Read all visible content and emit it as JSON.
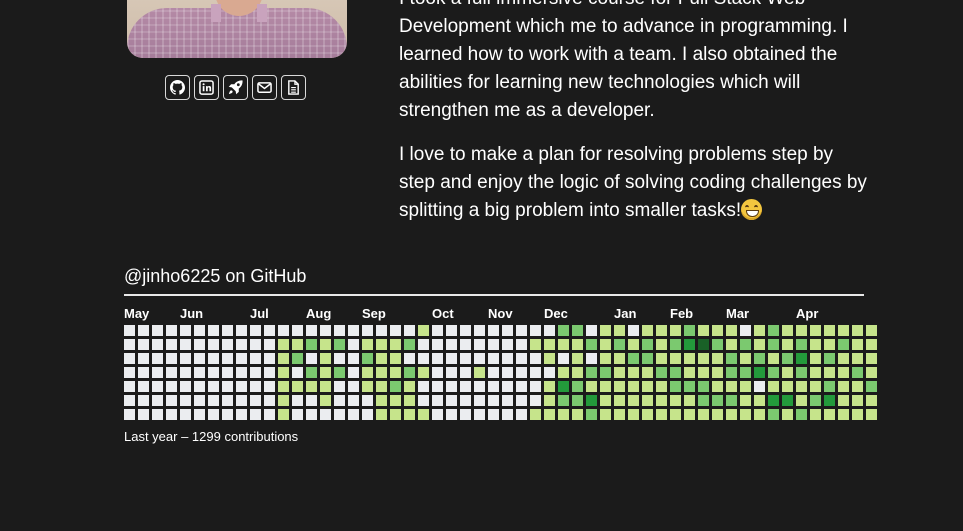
{
  "profile": {
    "photo_alt": "profile photo",
    "socials": [
      {
        "icon": "github-icon"
      },
      {
        "icon": "linkedin-icon"
      },
      {
        "icon": "rocket-icon"
      },
      {
        "icon": "mail-icon"
      },
      {
        "icon": "resume-icon"
      }
    ]
  },
  "about": {
    "p1": "I took a full immersive course for Full Stack Web Development which me to advance in programming. I learned how to work with a team. I also obtained the abilities for learning new technologies which will strengthen me as a developer.",
    "p2": "I love to make a plan for resolving problems step by step and enjoy the logic of solving coding challenges by splitting a big problem into smaller tasks!",
    "p2_emoji": "grinning-face-emoji"
  },
  "github": {
    "title": "@jinho6225 on GitHub",
    "months": [
      "May",
      "Jun",
      "Jul",
      "Aug",
      "Sep",
      "Oct",
      "Nov",
      "Dec",
      "Jan",
      "Feb",
      "Mar",
      "Apr"
    ],
    "caption": "Last year – 1299 contributions",
    "colors": [
      "#ebedf0",
      "#c6e48b",
      "#7bc96f",
      "#239a3b",
      "#196127"
    ],
    "weeks": [
      [
        0,
        0,
        0,
        0,
        0,
        0,
        0
      ],
      [
        0,
        0,
        0,
        0,
        0,
        0,
        0
      ],
      [
        0,
        0,
        0,
        0,
        0,
        0,
        0
      ],
      [
        0,
        0,
        0,
        0,
        0,
        0,
        0
      ],
      [
        0,
        0,
        0,
        0,
        0,
        0,
        0
      ],
      [
        0,
        0,
        0,
        0,
        0,
        0,
        0
      ],
      [
        0,
        0,
        0,
        0,
        0,
        0,
        0
      ],
      [
        0,
        0,
        0,
        0,
        0,
        0,
        0
      ],
      [
        0,
        0,
        0,
        0,
        0,
        0,
        0
      ],
      [
        0,
        0,
        0,
        0,
        0,
        0,
        0
      ],
      [
        0,
        0,
        0,
        0,
        0,
        0,
        0
      ],
      [
        0,
        1,
        1,
        1,
        1,
        1,
        1
      ],
      [
        0,
        1,
        2,
        0,
        1,
        0,
        0
      ],
      [
        0,
        2,
        0,
        2,
        1,
        0,
        0
      ],
      [
        0,
        1,
        1,
        1,
        1,
        1,
        0
      ],
      [
        0,
        2,
        0,
        2,
        0,
        0,
        0
      ],
      [
        0,
        0,
        0,
        0,
        0,
        0,
        0
      ],
      [
        0,
        1,
        2,
        1,
        1,
        0,
        0
      ],
      [
        0,
        1,
        1,
        1,
        1,
        1,
        1
      ],
      [
        0,
        1,
        1,
        1,
        2,
        1,
        1
      ],
      [
        0,
        2,
        0,
        2,
        1,
        1,
        1
      ],
      [
        1,
        0,
        0,
        1,
        0,
        0,
        1
      ],
      [
        0,
        0,
        0,
        0,
        0,
        0,
        0
      ],
      [
        0,
        0,
        0,
        0,
        0,
        0,
        0
      ],
      [
        0,
        0,
        0,
        0,
        0,
        0,
        0
      ],
      [
        0,
        0,
        0,
        1,
        0,
        0,
        0
      ],
      [
        0,
        0,
        0,
        0,
        0,
        0,
        0
      ],
      [
        0,
        0,
        0,
        0,
        0,
        0,
        0
      ],
      [
        0,
        0,
        0,
        0,
        0,
        0,
        0
      ],
      [
        0,
        1,
        0,
        0,
        0,
        0,
        1
      ],
      [
        0,
        1,
        1,
        0,
        1,
        1,
        1
      ],
      [
        2,
        1,
        0,
        1,
        3,
        2,
        1
      ],
      [
        2,
        1,
        1,
        1,
        2,
        2,
        1
      ],
      [
        0,
        2,
        0,
        2,
        1,
        3,
        2
      ],
      [
        1,
        1,
        1,
        2,
        1,
        1,
        1
      ],
      [
        1,
        2,
        1,
        1,
        1,
        1,
        1
      ],
      [
        0,
        1,
        2,
        1,
        1,
        1,
        1
      ],
      [
        1,
        2,
        2,
        1,
        1,
        1,
        1
      ],
      [
        1,
        1,
        1,
        2,
        1,
        1,
        1
      ],
      [
        1,
        2,
        1,
        2,
        2,
        1,
        1
      ],
      [
        2,
        3,
        1,
        1,
        2,
        1,
        1
      ],
      [
        1,
        4,
        1,
        1,
        2,
        2,
        1
      ],
      [
        1,
        2,
        1,
        1,
        1,
        2,
        1
      ],
      [
        1,
        1,
        2,
        2,
        1,
        2,
        1
      ],
      [
        0,
        2,
        1,
        2,
        1,
        1,
        1
      ],
      [
        1,
        1,
        2,
        3,
        0,
        1,
        1
      ],
      [
        2,
        2,
        1,
        2,
        1,
        3,
        2
      ],
      [
        1,
        1,
        2,
        1,
        1,
        3,
        1
      ],
      [
        1,
        2,
        3,
        2,
        1,
        1,
        2
      ],
      [
        1,
        1,
        1,
        1,
        1,
        2,
        1
      ],
      [
        1,
        1,
        2,
        1,
        2,
        3,
        1
      ],
      [
        1,
        2,
        1,
        1,
        1,
        1,
        1
      ],
      [
        1,
        1,
        1,
        2,
        1,
        1,
        1
      ],
      [
        1,
        1,
        1,
        1,
        2,
        1,
        1
      ]
    ]
  }
}
